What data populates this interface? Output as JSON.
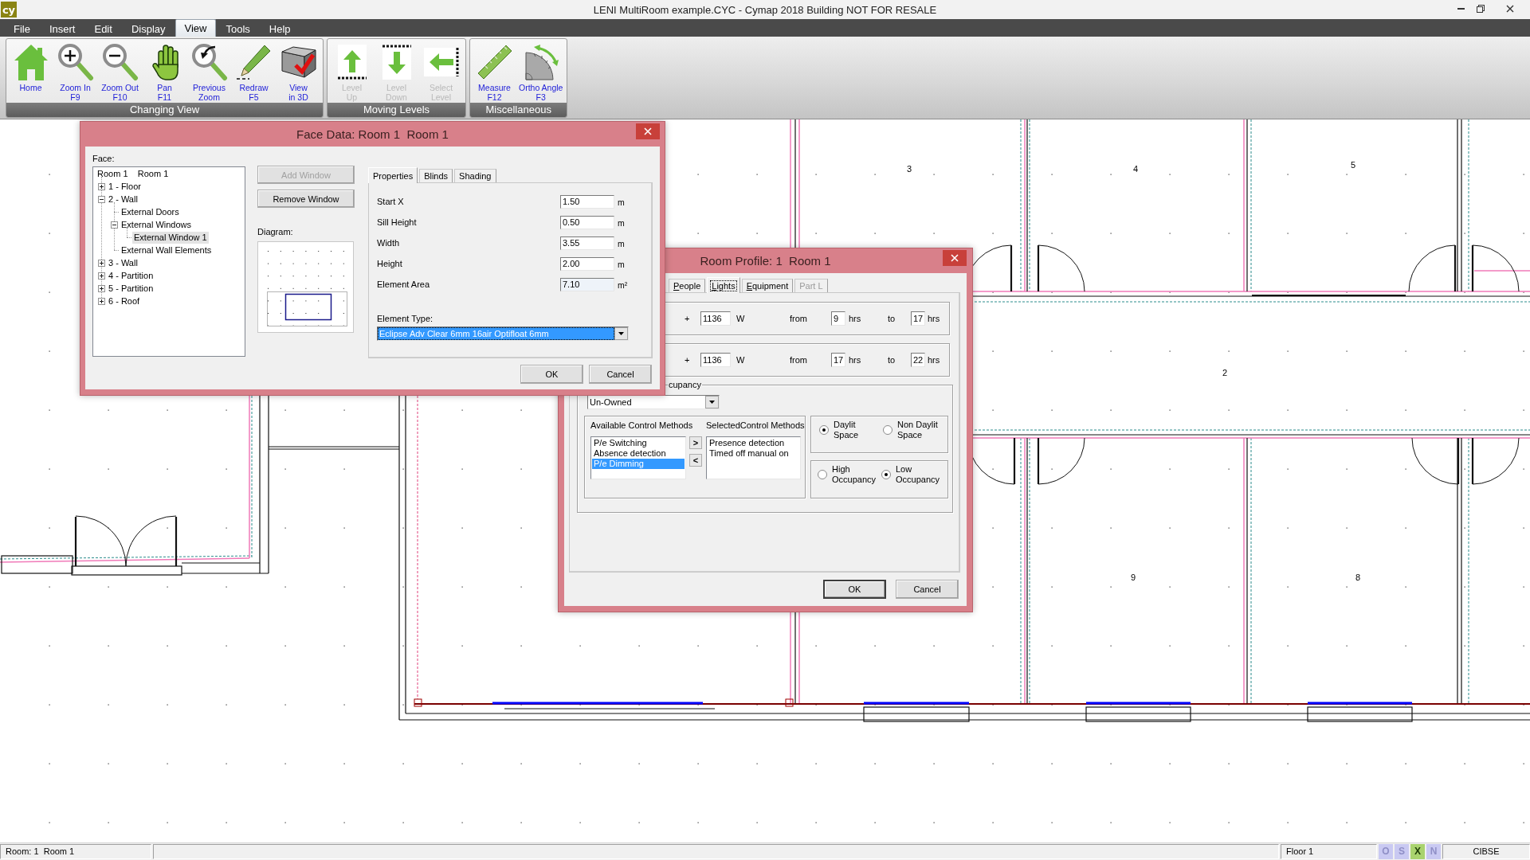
{
  "window": {
    "logo": "cy",
    "title": "LENI MultiRoom example.CYC - Cymap 2018 Building NOT FOR RESALE"
  },
  "menu": [
    {
      "label": "File",
      "selected": false
    },
    {
      "label": "Insert",
      "selected": false
    },
    {
      "label": "Edit",
      "selected": false
    },
    {
      "label": "Display",
      "selected": false
    },
    {
      "label": "View",
      "selected": true
    },
    {
      "label": "Tools",
      "selected": false
    },
    {
      "label": "Help",
      "selected": false
    }
  ],
  "ribbon": {
    "groups": [
      {
        "title": "Changing View",
        "buttons": [
          {
            "kind": "home",
            "label": "Home",
            "disabled": false
          },
          {
            "kind": "zoom_in",
            "label": "Zoom In\nF9",
            "disabled": false
          },
          {
            "kind": "zoom_out",
            "label": "Zoom Out\nF10",
            "disabled": false
          },
          {
            "kind": "pan",
            "label": "Pan\nF11",
            "disabled": false
          },
          {
            "kind": "previous_zoom",
            "label": "Previous\nZoom",
            "disabled": false
          },
          {
            "kind": "redraw",
            "label": "Redraw\nF5",
            "disabled": false
          },
          {
            "kind": "view_3d",
            "label": "View\nin 3D",
            "disabled": false
          }
        ]
      },
      {
        "title": "Moving Levels",
        "buttons": [
          {
            "kind": "level_up",
            "label": "Level\nUp",
            "disabled": true
          },
          {
            "kind": "level_down",
            "label": "Level\nDown",
            "disabled": true
          },
          {
            "kind": "select_level",
            "label": "Select\nLevel",
            "disabled": true
          }
        ]
      },
      {
        "title": "Miscellaneous",
        "buttons": [
          {
            "kind": "measure",
            "label": "Measure\nF12",
            "disabled": false
          },
          {
            "kind": "ortho_angle",
            "label": "Ortho Angle\nF3",
            "disabled": false
          }
        ]
      }
    ]
  },
  "plan": {
    "room_numbers": [
      "3",
      "4",
      "5",
      "2",
      "9",
      "8"
    ]
  },
  "face_data_dialog": {
    "title": "Face Data: Room 1  Room 1",
    "face_label": "Face:",
    "tree": {
      "label": "Room 1    Room 1",
      "selected": false,
      "children": [
        {
          "label": "1 - Floor",
          "kind": "branch",
          "expanded": false,
          "selected": false
        },
        {
          "label": "2 - Wall",
          "kind": "branch",
          "expanded": true,
          "selected": false,
          "children": [
            {
              "label": "External Doors",
              "kind": "leaf",
              "selected": false
            },
            {
              "label": "External Windows",
              "kind": "branch",
              "expanded": true,
              "selected": false,
              "children": [
                {
                  "label": "External Window 1",
                  "kind": "leaf",
                  "selected": true
                }
              ]
            },
            {
              "label": "External Wall Elements",
              "kind": "leaf",
              "selected": false
            }
          ]
        },
        {
          "label": "3 - Wall",
          "kind": "branch",
          "expanded": false,
          "selected": false
        },
        {
          "label": "4 - Partition",
          "kind": "branch",
          "expanded": false,
          "selected": false
        },
        {
          "label": "5 - Partition",
          "kind": "branch",
          "expanded": false,
          "selected": false
        },
        {
          "label": "6 - Roof",
          "kind": "branch",
          "expanded": false,
          "selected": false
        }
      ]
    },
    "buttons": [
      {
        "label": "Add Window",
        "disabled": true
      },
      {
        "label": "Remove Window",
        "disabled": false
      }
    ],
    "diagram_label": "Diagram:",
    "tabs": [
      {
        "label": "Properties",
        "selected": true
      },
      {
        "label": "Blinds",
        "selected": false
      },
      {
        "label": "Shading",
        "selected": false
      }
    ],
    "fields": [
      {
        "label": "Start X",
        "value": "1.50",
        "unit": "m",
        "readonly": false
      },
      {
        "label": "Sill Height",
        "value": "0.50",
        "unit": "m",
        "readonly": false
      },
      {
        "label": "Width",
        "value": "3.55",
        "unit": "m",
        "readonly": false
      },
      {
        "label": "Height",
        "value": "2.00",
        "unit": "m",
        "readonly": false
      },
      {
        "label": "Element Area",
        "value": "7.10",
        "unit": "m²",
        "readonly": true
      }
    ],
    "element_type": {
      "label": "Element Type:",
      "value": "Eclipse Adv Clear 6mm 16air Optifloat 6mm"
    },
    "actions": [
      {
        "label": "OK",
        "default": false
      },
      {
        "label": "Cancel",
        "default": false
      }
    ]
  },
  "room_profile_dialog": {
    "title": "Room Profile: 1  Room 1",
    "tabs": [
      {
        "label": "People",
        "selected": false,
        "disabled": false,
        "mnemonic": true,
        "focused": false
      },
      {
        "label": "Lights",
        "selected": true,
        "disabled": false,
        "mnemonic": true,
        "focused": true
      },
      {
        "label": "Equipment",
        "selected": false,
        "disabled": false,
        "mnemonic": true,
        "focused": false
      },
      {
        "label": "Part L",
        "selected": false,
        "disabled": true,
        "mnemonic": false,
        "focused": false
      }
    ],
    "light_rows": [
      {
        "sign": "+",
        "power": "1136",
        "power_unit": "W",
        "from_label": "from",
        "from": "9",
        "from_unit": "hrs",
        "to_label": "to",
        "to": "17",
        "to_unit": "hrs"
      },
      {
        "sign": "+",
        "power": "1136",
        "power_unit": "W",
        "from_label": "from",
        "from": "17",
        "from_unit": "hrs",
        "to_label": "to",
        "to": "22",
        "to_unit": "hrs"
      }
    ],
    "occupancy_group": {
      "legend": "cupancy",
      "ownership": "Un-Owned",
      "available_header": "Available Control Methods",
      "selected_header": "SelectedControl Methods",
      "available_methods": [
        {
          "label": "P/e Switching",
          "selected": false
        },
        {
          "label": "Absence detection",
          "selected": false
        },
        {
          "label": "P/e Dimming",
          "selected": true
        }
      ],
      "move_buttons": [
        ">",
        "<"
      ],
      "selected_methods": [
        "Presence detection",
        "Timed off manual on"
      ],
      "daylight_options": [
        {
          "label": "Daylit\nSpace",
          "selected": true
        },
        {
          "label": "Non Daylit\nSpace",
          "selected": false
        }
      ],
      "occupancy_options": [
        {
          "label": "High\nOccupancy",
          "selected": false
        },
        {
          "label": "Low\nOccupancy",
          "selected": true
        }
      ]
    },
    "actions": [
      {
        "label": "OK",
        "default": true
      },
      {
        "label": "Cancel",
        "default": false
      }
    ]
  },
  "status_bar": {
    "room": "Room: 1  Room 1",
    "floor": "Floor 1",
    "indicators": [
      {
        "label": "O",
        "on": false
      },
      {
        "label": "S",
        "on": false
      },
      {
        "label": "X",
        "on": true
      },
      {
        "label": "N",
        "on": false
      }
    ],
    "standard": "CIBSE"
  }
}
